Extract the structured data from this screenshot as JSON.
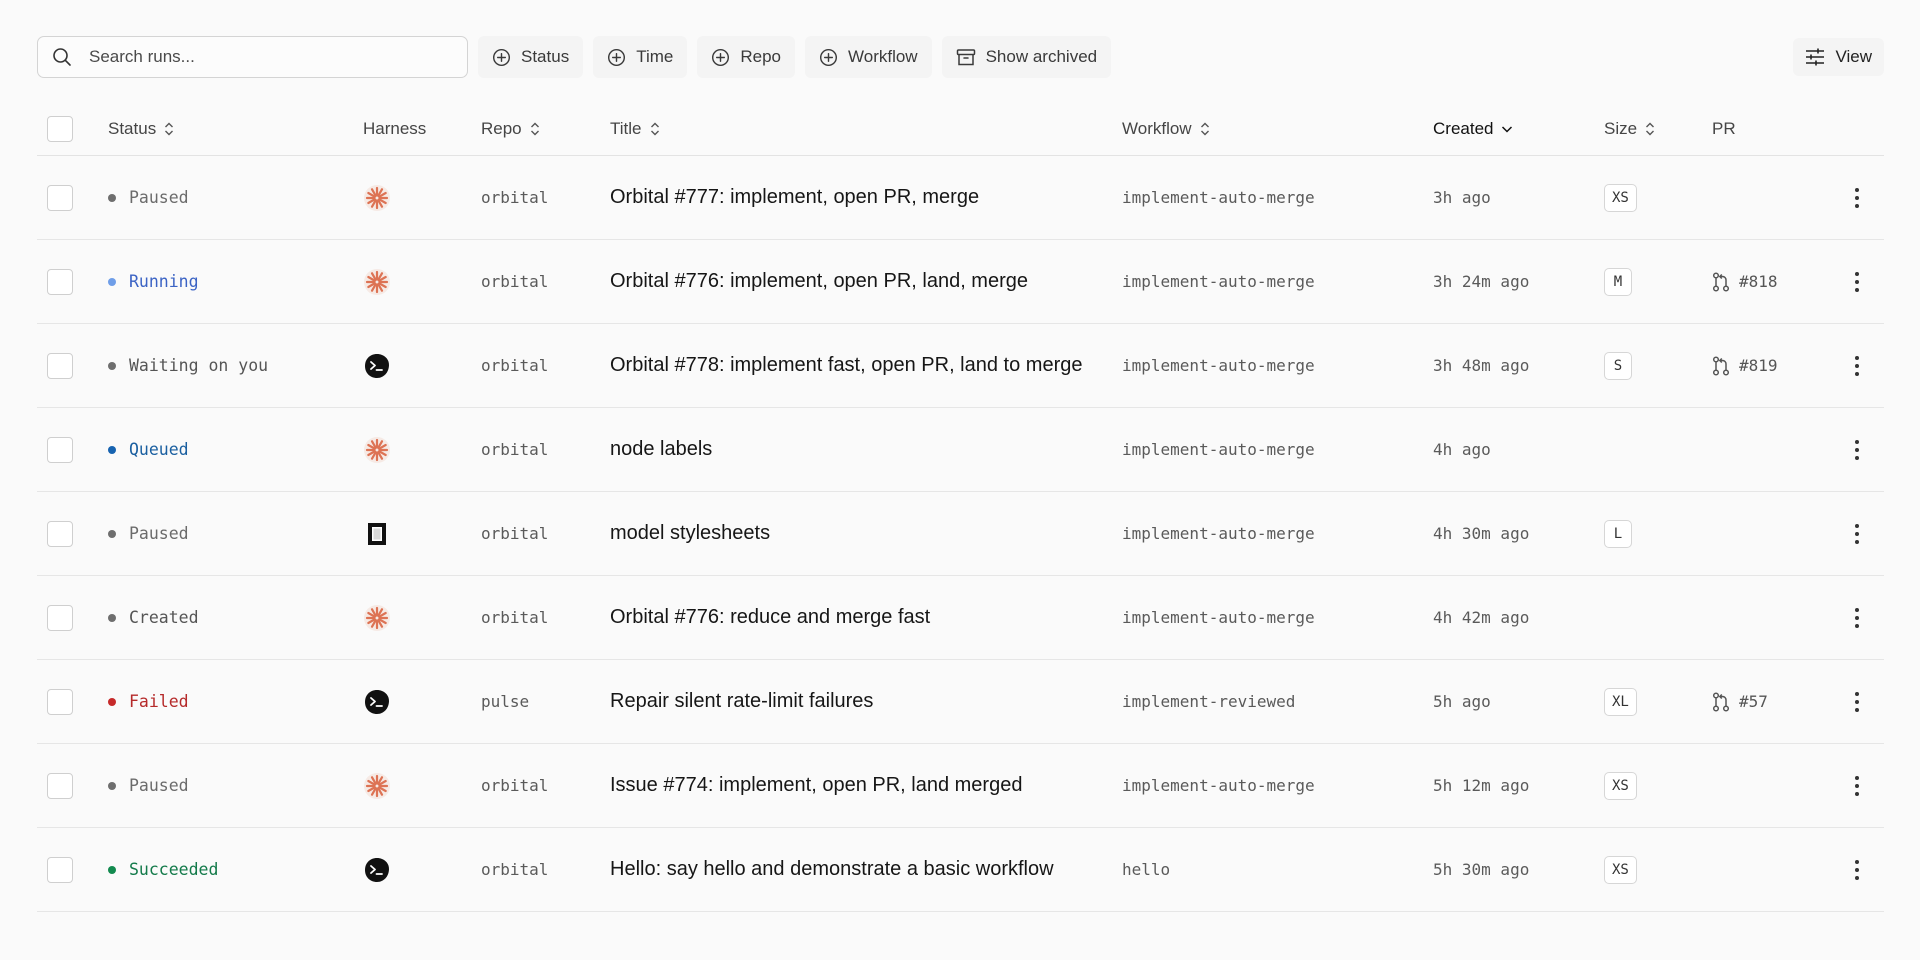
{
  "toolbar": {
    "search_placeholder": "Search runs...",
    "filters": [
      {
        "label": "Status"
      },
      {
        "label": "Time"
      },
      {
        "label": "Repo"
      },
      {
        "label": "Workflow"
      }
    ],
    "show_archived": "Show archived",
    "view": "View"
  },
  "table": {
    "columns": {
      "status": "Status",
      "harness": "Harness",
      "repo": "Repo",
      "title": "Title",
      "workflow": "Workflow",
      "created": "Created",
      "size": "Size",
      "pr": "PR"
    },
    "rows": [
      {
        "status": "Paused",
        "harness": "sunburst-icon",
        "repo": "orbital",
        "title": "Orbital #777: implement, open PR, merge",
        "workflow": "implement-auto-merge",
        "created": "3h ago",
        "size": "XS",
        "pr": ""
      },
      {
        "status": "Running",
        "harness": "sunburst-icon",
        "repo": "orbital",
        "title": "Orbital #776: implement, open PR, land, merge",
        "workflow": "implement-auto-merge",
        "created": "3h 24m ago",
        "size": "M",
        "pr": "#818"
      },
      {
        "status": "Waiting on you",
        "harness": "terminal-blob-icon",
        "repo": "orbital",
        "title": "Orbital #778: implement fast, open PR, land to merge",
        "workflow": "implement-auto-merge",
        "created": "3h 48m ago",
        "size": "S",
        "pr": "#819"
      },
      {
        "status": "Queued",
        "harness": "sunburst-icon",
        "repo": "orbital",
        "title": "node labels",
        "workflow": "implement-auto-merge",
        "created": "4h ago",
        "size": "",
        "pr": ""
      },
      {
        "status": "Paused",
        "harness": "square-frame-icon",
        "repo": "orbital",
        "title": "model stylesheets",
        "workflow": "implement-auto-merge",
        "created": "4h 30m ago",
        "size": "L",
        "pr": ""
      },
      {
        "status": "Created",
        "harness": "sunburst-icon",
        "repo": "orbital",
        "title": "Orbital #776: reduce and merge fast",
        "workflow": "implement-auto-merge",
        "created": "4h 42m ago",
        "size": "",
        "pr": ""
      },
      {
        "status": "Failed",
        "harness": "terminal-blob-icon",
        "repo": "pulse",
        "title": "Repair silent rate-limit failures",
        "workflow": "implement-reviewed",
        "created": "5h ago",
        "size": "XL",
        "pr": "#57"
      },
      {
        "status": "Paused",
        "harness": "sunburst-icon",
        "repo": "orbital",
        "title": "Issue #774: implement, open PR, land merged",
        "workflow": "implement-auto-merge",
        "created": "5h 12m ago",
        "size": "XS",
        "pr": ""
      },
      {
        "status": "Succeeded",
        "harness": "terminal-blob-icon",
        "repo": "orbital",
        "title": "Hello: say hello and demonstrate a basic workflow",
        "workflow": "hello",
        "created": "5h 30m ago",
        "size": "XS",
        "pr": ""
      }
    ]
  },
  "status_colors": {
    "Paused": "#6b6b6b",
    "Running": "#3b63c4",
    "Waiting on you": "#555555",
    "Queued": "#1a5fa0",
    "Created": "#555555",
    "Failed": "#b52a2a",
    "Succeeded": "#137a4a"
  },
  "status_dot_colors": {
    "Paused": "#6e6e6e",
    "Running": "#6f9ee8",
    "Waiting on you": "#6e6e6e",
    "Queued": "#1763b0",
    "Created": "#6e6e6e",
    "Failed": "#c62a2a",
    "Succeeded": "#138a4f"
  },
  "harness_colors": {
    "sunburst": "#dd7354",
    "terminal": "#111111"
  }
}
